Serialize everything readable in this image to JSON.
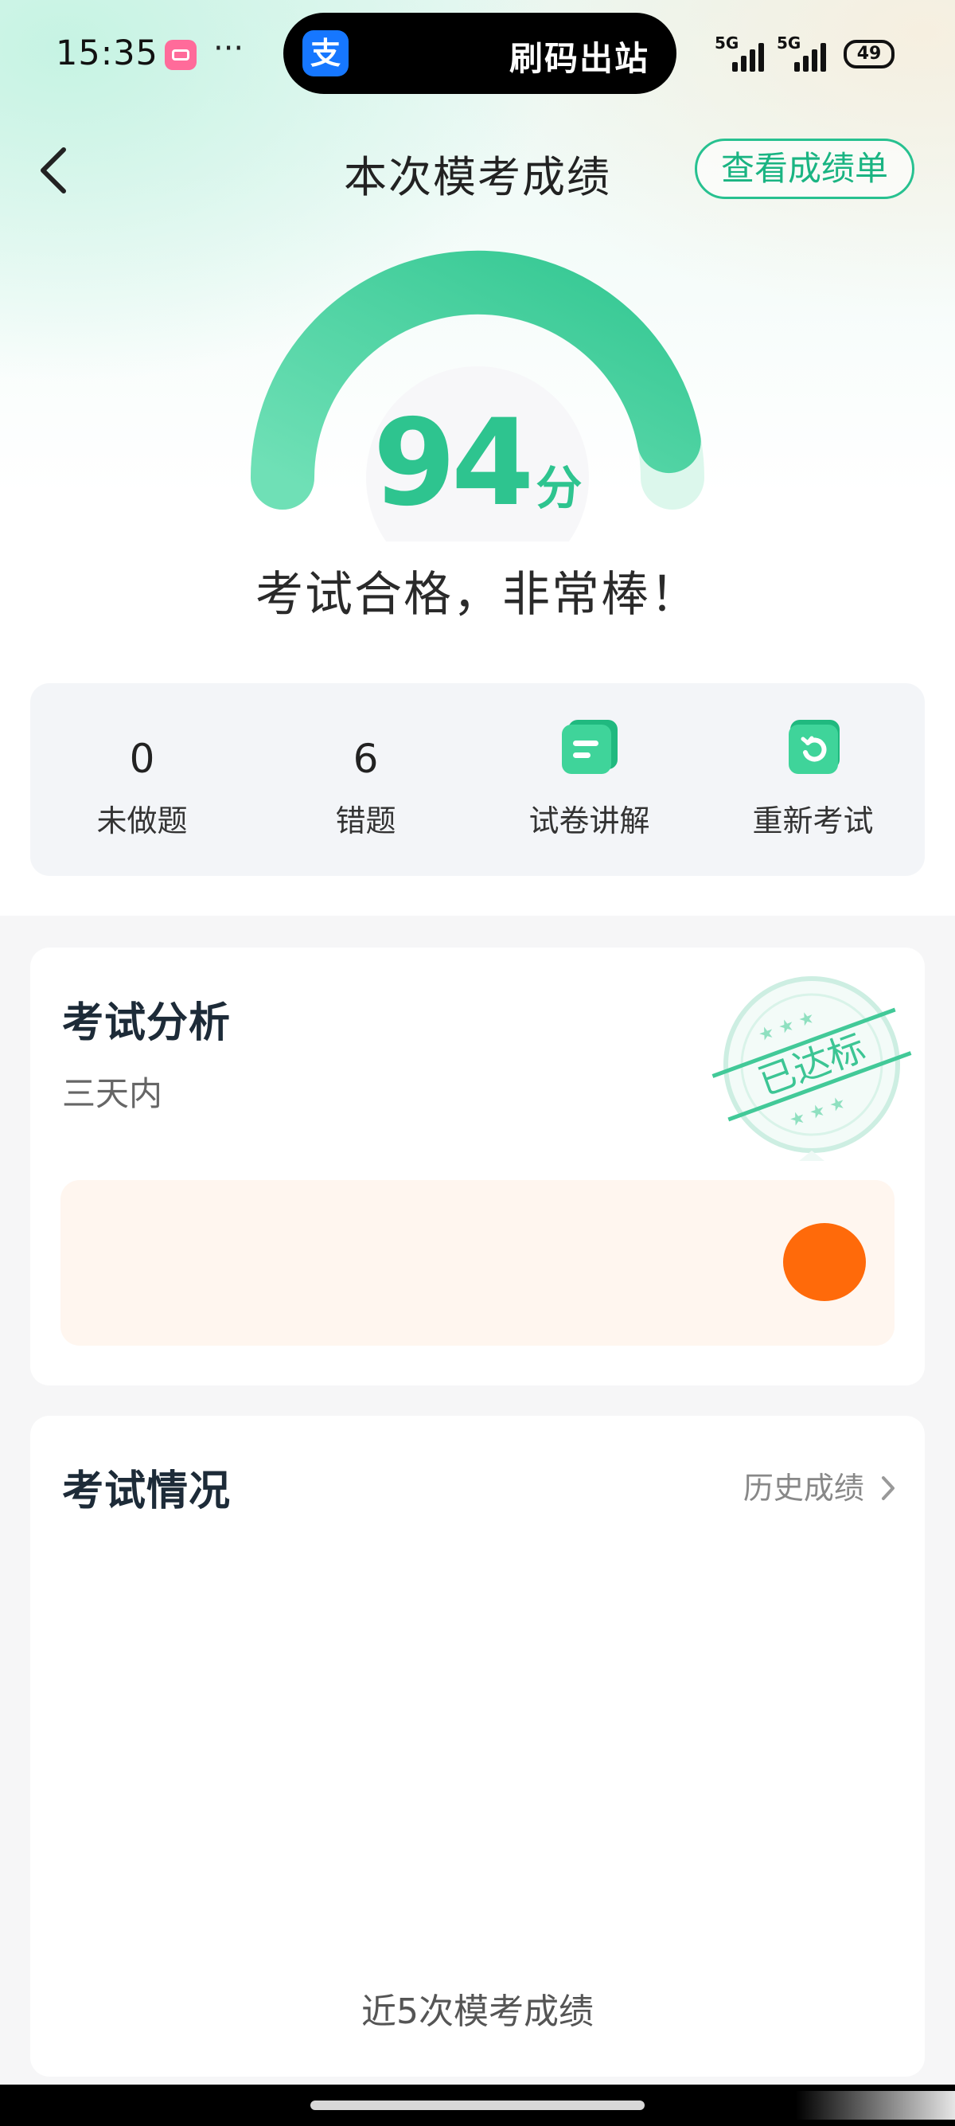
{
  "colors": {
    "accent": "#2ec48f",
    "accent_dark": "#1ab482",
    "warning": "#ff6a0a",
    "analysis_bg": "#fff6ef",
    "stats_bg": "#f3f5f8"
  },
  "status_bar": {
    "time": "15:35",
    "dots": "···",
    "pill_icon": "alipay-icon",
    "pill_icon_char": "支",
    "pill_text": "刷码出站",
    "network_1": "5G",
    "network_2": "5G",
    "battery": "49"
  },
  "header": {
    "title": "本次模考成绩",
    "report_button": "查看成绩单",
    "back_icon": "chevron-left-icon"
  },
  "score": {
    "value": "94",
    "unit": "分",
    "gauge_fill_fraction": 0.94,
    "result_text": "考试合格，非常棒！"
  },
  "stats": [
    {
      "value": "0",
      "label": "未做题"
    },
    {
      "value": "6",
      "label": "错题"
    },
    {
      "icon": "document-icon",
      "label": "试卷讲解"
    },
    {
      "icon": "refresh-icon",
      "label": "重新考试"
    }
  ],
  "analysis": {
    "title": "考试分析",
    "subtitle": "三天内",
    "stamp_text": "已达标"
  },
  "exam_status": {
    "title": "考试情况",
    "history_link": "历史成绩",
    "chart_caption": "近5次模考成绩"
  }
}
